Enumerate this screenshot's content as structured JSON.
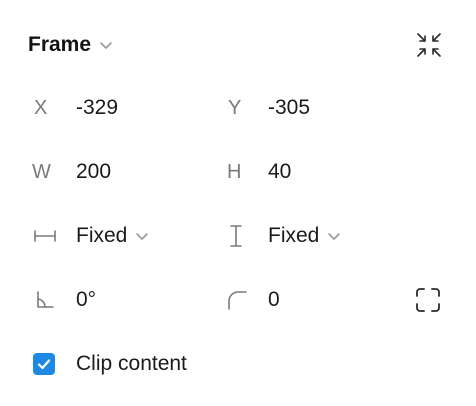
{
  "header": {
    "title": "Frame"
  },
  "position": {
    "x_label": "X",
    "x_value": "-329",
    "y_label": "Y",
    "y_value": "-305"
  },
  "size": {
    "w_label": "W",
    "w_value": "200",
    "h_label": "H",
    "h_value": "40"
  },
  "resizing": {
    "horizontal": "Fixed",
    "vertical": "Fixed"
  },
  "transform": {
    "rotation": "0°",
    "corner_radius": "0"
  },
  "clip": {
    "label": "Clip content",
    "checked": true
  },
  "colors": {
    "accent": "#1e88e5",
    "label_gray": "#7a7a7a",
    "text": "#1a1a1a"
  },
  "icons": {
    "collapse": "collapse-arrows-icon",
    "horizontal_resize": "horizontal-resize-icon",
    "vertical_resize": "vertical-resize-icon",
    "rotation": "rotation-angle-icon",
    "corner_radius": "corner-radius-icon",
    "independent_corners": "independent-corners-icon",
    "check": "checkmark-icon"
  }
}
